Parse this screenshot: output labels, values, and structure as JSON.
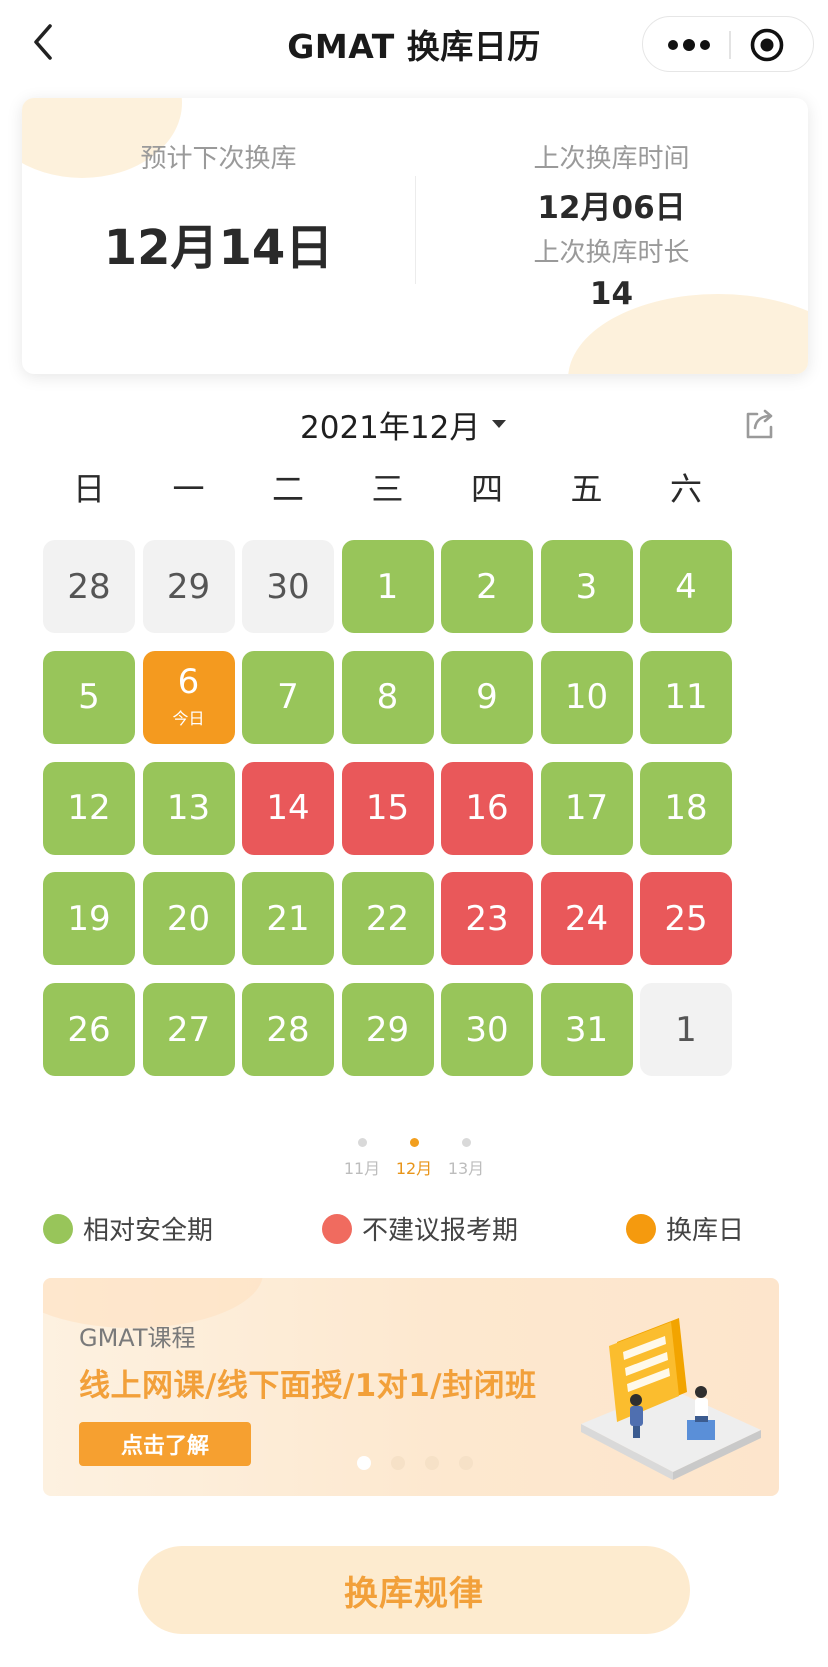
{
  "navbar": {
    "title": "GMAT 换库日历",
    "icons": {
      "back": "chevron-left-icon",
      "more": "more-dots-icon",
      "close": "target-circle-icon"
    }
  },
  "summary": {
    "next_label": "预计下次换库",
    "next_value": "12月14日",
    "last_time_label": "上次换库时间",
    "last_time_value": "12月06日",
    "last_duration_label": "上次换库时长",
    "last_duration_value": "14"
  },
  "calendar": {
    "month_label": "2021年12月",
    "weekdays": [
      "日",
      "一",
      "二",
      "三",
      "四",
      "五",
      "六"
    ],
    "today_tag": "今日",
    "days": [
      {
        "d": "28",
        "s": "other"
      },
      {
        "d": "29",
        "s": "other"
      },
      {
        "d": "30",
        "s": "other"
      },
      {
        "d": "1",
        "s": "safe"
      },
      {
        "d": "2",
        "s": "safe"
      },
      {
        "d": "3",
        "s": "safe"
      },
      {
        "d": "4",
        "s": "safe"
      },
      {
        "d": "5",
        "s": "safe"
      },
      {
        "d": "6",
        "s": "today"
      },
      {
        "d": "7",
        "s": "safe"
      },
      {
        "d": "8",
        "s": "safe"
      },
      {
        "d": "9",
        "s": "safe"
      },
      {
        "d": "10",
        "s": "safe"
      },
      {
        "d": "11",
        "s": "safe"
      },
      {
        "d": "12",
        "s": "safe"
      },
      {
        "d": "13",
        "s": "safe"
      },
      {
        "d": "14",
        "s": "avoid"
      },
      {
        "d": "15",
        "s": "avoid"
      },
      {
        "d": "16",
        "s": "avoid"
      },
      {
        "d": "17",
        "s": "safe"
      },
      {
        "d": "18",
        "s": "safe"
      },
      {
        "d": "19",
        "s": "safe"
      },
      {
        "d": "20",
        "s": "safe"
      },
      {
        "d": "21",
        "s": "safe"
      },
      {
        "d": "22",
        "s": "safe"
      },
      {
        "d": "23",
        "s": "avoid"
      },
      {
        "d": "24",
        "s": "avoid"
      },
      {
        "d": "25",
        "s": "avoid"
      },
      {
        "d": "26",
        "s": "safe"
      },
      {
        "d": "27",
        "s": "safe"
      },
      {
        "d": "28",
        "s": "safe"
      },
      {
        "d": "29",
        "s": "safe"
      },
      {
        "d": "30",
        "s": "safe"
      },
      {
        "d": "31",
        "s": "safe"
      },
      {
        "d": "1",
        "s": "other"
      }
    ],
    "pager": [
      {
        "label": "11月",
        "active": false
      },
      {
        "label": "12月",
        "active": true
      },
      {
        "label": "13月",
        "active": false
      }
    ]
  },
  "legend": {
    "safe": "相对安全期",
    "avoid": "不建议报考期",
    "change": "换库日"
  },
  "colors": {
    "safe": "#98c55a",
    "avoid": "#e9585a",
    "today": "#f49a1f",
    "other": "#f2f2f2",
    "legend_avoid": "#f06b5f",
    "legend_change": "#f59a0e",
    "accent": "#f2a03a"
  },
  "banner": {
    "subtitle": "GMAT课程",
    "title": "线上网课/线下面授/1对1/封闭班",
    "button": "点击了解",
    "slides": 4,
    "active_slide": 0
  },
  "rule_button": "换库规律"
}
